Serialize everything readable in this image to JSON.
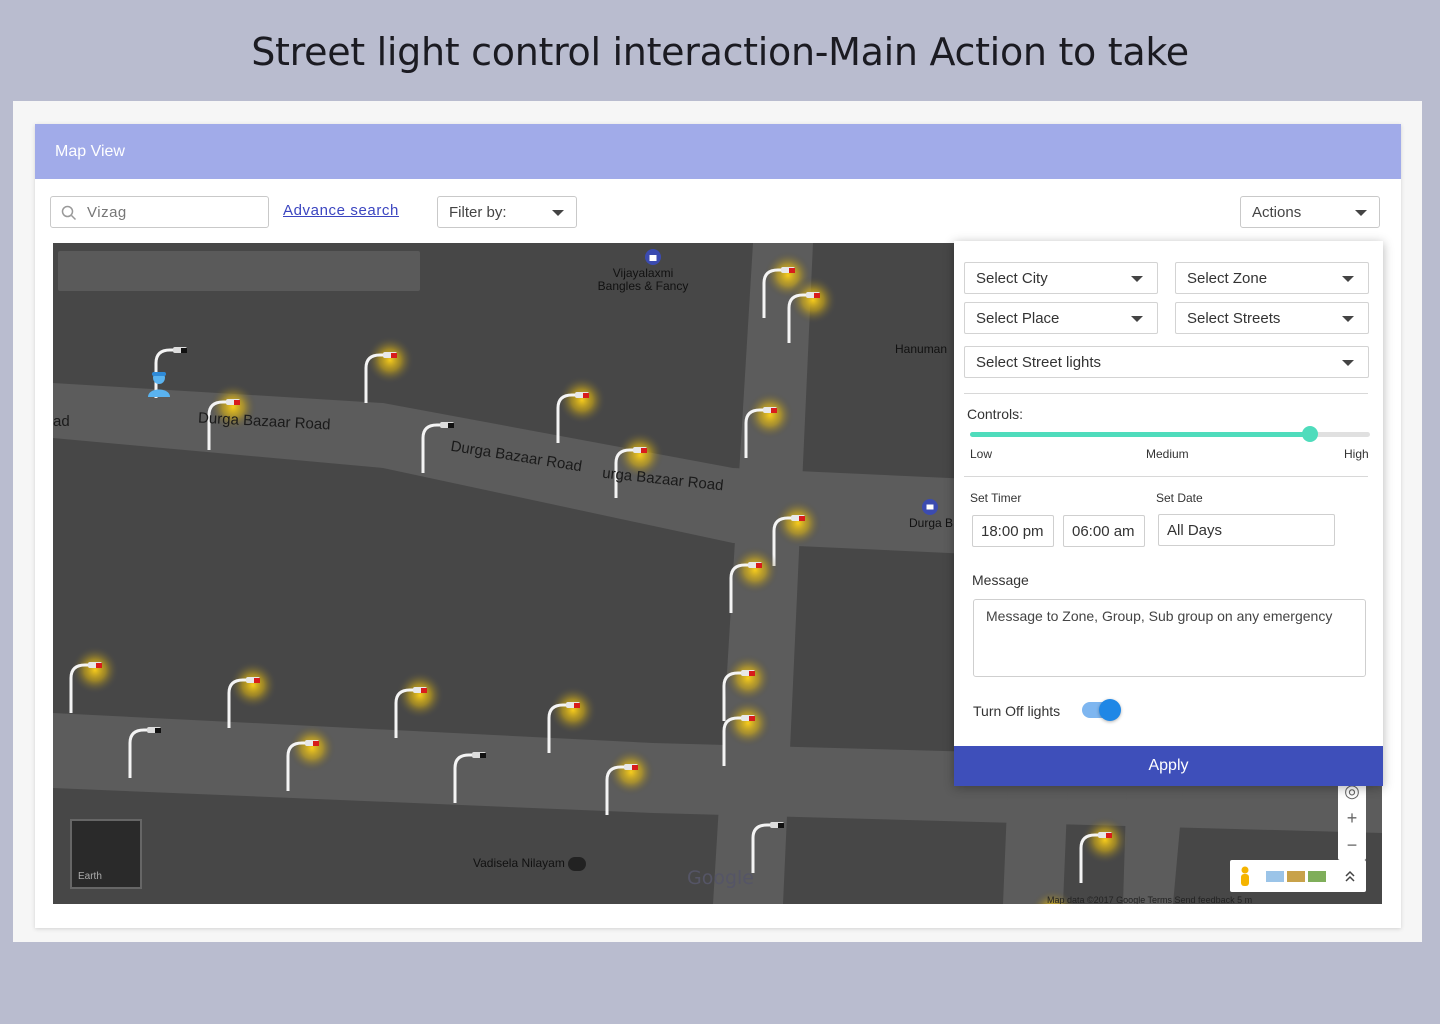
{
  "page": {
    "heading": "Street light control interaction-Main Action to take"
  },
  "card": {
    "title": "Map View"
  },
  "toolbar": {
    "search_value": "Vizag",
    "advance_search": "Advance search",
    "filter_label": "Filter by:",
    "actions_label": "Actions"
  },
  "map": {
    "places": {
      "shop": "Vijayalaxmi\nBangles & Fancy",
      "hanuman": "Hanuman",
      "durga": "Durga B",
      "vadisela": "Vadisela Nilayam"
    },
    "roads": {
      "left": "ad",
      "road1": "Durga Bazaar Road",
      "road2": "Durga Bazaar Road",
      "road3": "urga Bazaar Road"
    },
    "earth_label": "Earth",
    "google_logo": "Google",
    "attribution": "Map data ©2017 Google     Terms     Send feedback     5 m"
  },
  "panel": {
    "select_city": "Select City",
    "select_zone": "Select Zone",
    "select_place": "Select Place",
    "select_streets": "Select Streets",
    "select_street_lights": "Select Street lights",
    "controls_label": "Controls:",
    "slider": {
      "level": 0.85,
      "low": "Low",
      "medium": "Medium",
      "high": "High"
    },
    "set_timer_label": "Set Timer",
    "timer_start": "18:00 pm",
    "timer_end": "06:00 am",
    "set_date_label": "Set Date",
    "date_value": "All Days",
    "message_label": "Message",
    "message_placeholder": "Message to Zone, Group, Sub group on any emergency",
    "turn_off_label": "Turn Off lights",
    "turn_off_enabled": true,
    "apply_label": "Apply"
  },
  "colors": {
    "header": "#a1abe9",
    "accent": "#3e4fba",
    "slider": "#4fdcbc",
    "toggle": "#1f87e6",
    "road": "#5c5c5c",
    "map_bg": "#474747",
    "light_glow": "#ffd21a"
  },
  "icons": [
    "search-icon",
    "street-light-icon",
    "worker-icon",
    "shopping-bag-icon",
    "cart-icon",
    "location-target-icon",
    "pegman-icon",
    "expand-icon"
  ]
}
